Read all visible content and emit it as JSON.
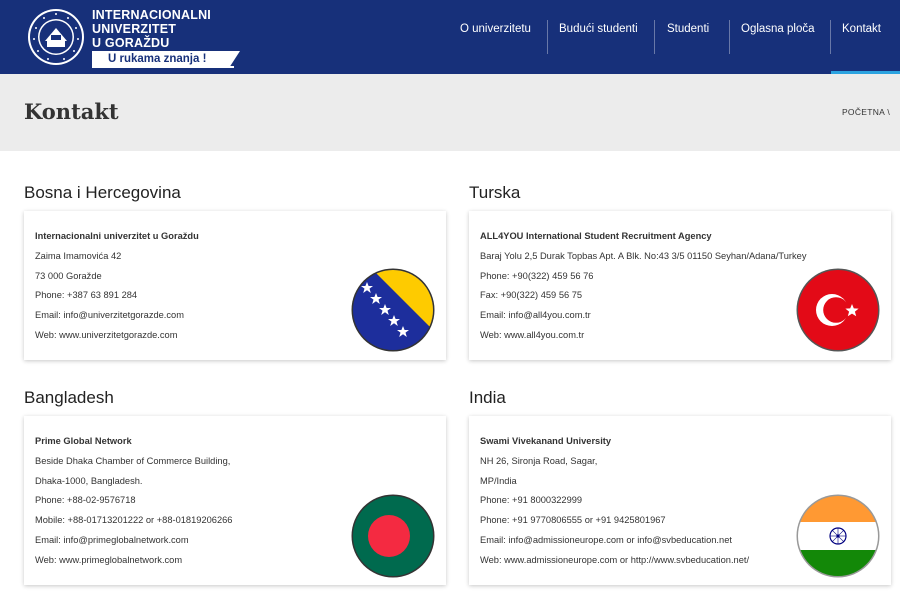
{
  "header": {
    "brand_lines": [
      "INTERNACIONALNI",
      "UNIVERZITET",
      "U GORAŽDU"
    ],
    "tagline": "U rukama znanja !",
    "nav": [
      "O univerzitetu",
      "Budući studenti",
      "Studenti",
      "Oglasna ploča",
      "Kontakt"
    ],
    "active_nav": "Kontakt",
    "colors": {
      "nav_bg": "#17307a",
      "active_bar": "#2ba3e0"
    }
  },
  "page": {
    "title": "Kontakt",
    "breadcrumb": "POČETNA \\"
  },
  "contacts": [
    {
      "country": "Bosna i Hercegovina",
      "flag": "bosnia-flag",
      "lines": [
        "Internacionalni univerzitet u Goraždu",
        "Zaima Imamovića 42",
        "73 000 Goražde",
        "Phone: +387 63 891 284",
        "Email: info@univerzitetgorazde.com",
        "Web: www.univerzitetgorazde.com"
      ]
    },
    {
      "country": "Turska",
      "flag": "turkey-flag",
      "lines": [
        "ALL4YOU International Student Recruitment Agency",
        "Baraj Yolu 2,5 Durak Topbas Apt. A Blk. No:43 3/5  01150 Seyhan/Adana/Turkey",
        "Phone: +90(322) 459 56 76",
        "Fax: +90(322) 459 56 75",
        "Email: info@all4you.com.tr",
        "Web: www.all4you.com.tr"
      ]
    },
    {
      "country": "Bangladesh",
      "flag": "bangladesh-flag",
      "lines": [
        "Prime Global Network",
        "Beside Dhaka Chamber of Commerce Building,",
        "Dhaka-1000, Bangladesh.",
        "Phone: +88-02-9576718",
        "Mobile: +88-01713201222 or +88-01819206266",
        "Email: info@primeglobalnetwork.com",
        "Web: www.primeglobalnetwork.com"
      ]
    },
    {
      "country": "India",
      "flag": "india-flag",
      "lines": [
        "Swami Vivekanand University",
        "NH 26, Sironja Road, Sagar,",
        "MP/India",
        "Phone: +91 8000322999",
        "Phone: +91 9770806555 or +91 9425801967",
        "Email: info@admissioneurope.com or info@svbeducation.net",
        "Web: www.admissioneurope.com or http://www.svbeducation.net/"
      ]
    }
  ]
}
